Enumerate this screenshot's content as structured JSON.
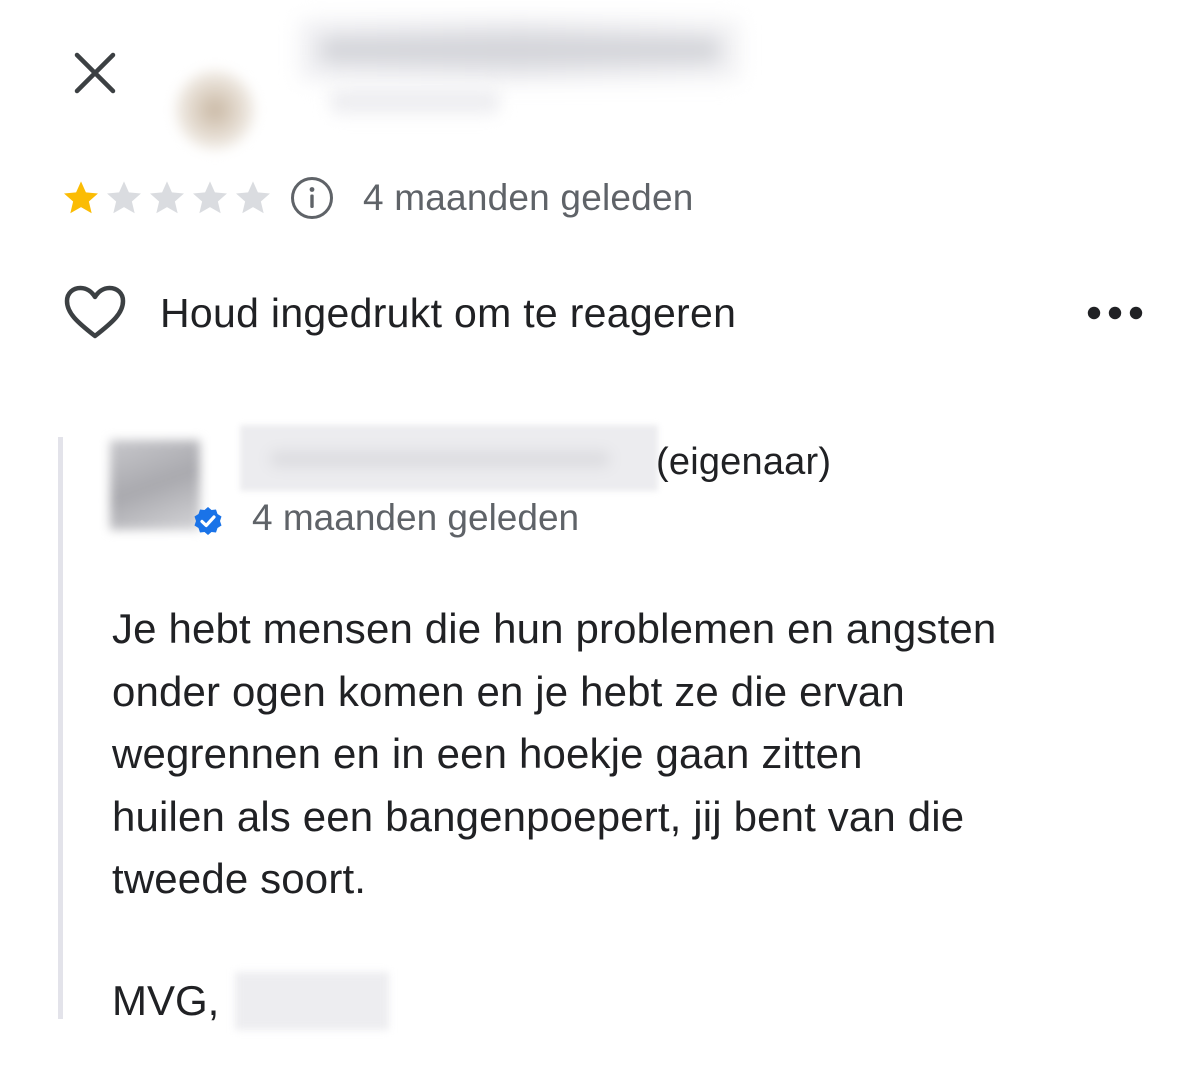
{
  "header": {
    "close_icon": "close-icon"
  },
  "rating": {
    "stars_filled": 1,
    "stars_total": 5,
    "star_color": "#fbbc04",
    "star_empty_color": "#dadce0",
    "time": "4 maanden geleden"
  },
  "react": {
    "label": "Houd ingedrukt om te reageren",
    "heart_icon": "heart-icon",
    "more_icon": "more-horizontal-icon"
  },
  "owner_reply": {
    "tag": "(eigenaar)",
    "time": "4 maanden geleden",
    "verified_color": "#1a73e8",
    "lines": [
      "Je hebt mensen die hun problemen en angsten",
      "onder ogen komen en je hebt ze die ervan",
      "wegrennen en in een hoekje gaan zitten",
      "huilen als een bangenpoepert, jij bent van die",
      "tweede soort."
    ],
    "signoff": "MVG,"
  }
}
